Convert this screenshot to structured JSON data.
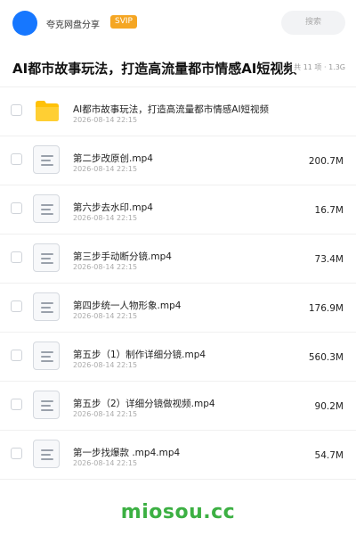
{
  "header": {
    "app_name": "夸克网盘分享",
    "badge": "SVIP",
    "search_placeholder": "搜索"
  },
  "folder": {
    "title": "AI都市故事玩法，打造高流量都市情感AI短视频",
    "meta": "共 11 项 · 1.3G"
  },
  "files": [
    {
      "name": "AI都市故事玩法，打造高流量都市情感AI短视频",
      "date": "2026-08-14 22:15",
      "size": "",
      "icon": "folder-icon"
    },
    {
      "name": "第二步改原创.mp4",
      "date": "2026-08-14 22:15",
      "size": "200.7M",
      "icon": "file-icon"
    },
    {
      "name": "第六步去水印.mp4",
      "date": "2026-08-14 22:15",
      "size": "16.7M",
      "icon": "file-icon"
    },
    {
      "name": "第三步手动断分镜.mp4",
      "date": "2026-08-14 22:15",
      "size": "73.4M",
      "icon": "file-icon"
    },
    {
      "name": "第四步统一人物形象.mp4",
      "date": "2026-08-14 22:15",
      "size": "176.9M",
      "icon": "file-icon"
    },
    {
      "name": "第五步（1）制作详细分镜.mp4",
      "date": "2026-08-14 22:15",
      "size": "560.3M",
      "icon": "file-icon"
    },
    {
      "name": "第五步（2）详细分镜做视频.mp4",
      "date": "2026-08-14 22:15",
      "size": "90.2M",
      "icon": "file-icon"
    },
    {
      "name": "第一步找爆款 .mp4.mp4",
      "date": "2026-08-14 22:15",
      "size": "54.7M",
      "icon": "file-icon"
    }
  ],
  "watermark": "miosou.cc",
  "colors": {
    "accent": "#1677ff",
    "svip": "#f5a623",
    "folder": "#ffc107",
    "watermark": "#3cb043"
  }
}
